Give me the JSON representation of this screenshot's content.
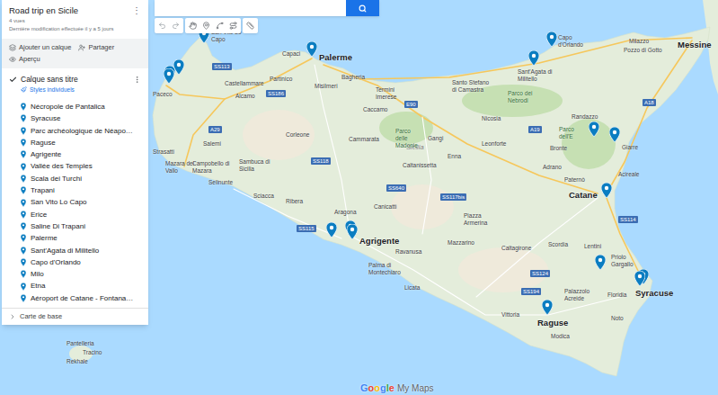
{
  "map": {
    "title": "Road trip en Sicile",
    "views": "4 vues",
    "modified": "Dernière modification effectuée il y a 5 jours",
    "menu": "⋮"
  },
  "actions": [
    {
      "label": "Ajouter un calque"
    },
    {
      "label": "Partager"
    },
    {
      "label": "Aperçu"
    }
  ],
  "layer": {
    "title": "Calque sans titre",
    "checked": true,
    "style": "Styles individuels",
    "items": [
      "Nécropole de Pantalica",
      "Syracuse",
      "Parc archéologique de Néapo…",
      "Raguse",
      "Agrigente",
      "Vallée des Temples",
      "Scala dei Turchi",
      "Trapani",
      "San Vito Lo Capo",
      "Erice",
      "Saline Di Trapani",
      "Palerme",
      "Sant'Agata di Militello",
      "Capo d'Orlando",
      "Milo",
      "Etna",
      "Aéroport de Catane - Fontana…"
    ]
  },
  "base_map": {
    "label": "Carte de base",
    "expanded": false
  },
  "map_labels": [
    {
      "text": "Palerme",
      "kind": "major"
    },
    {
      "text": "Paceco",
      "kind": "city"
    },
    {
      "text": "San Vito Lo Capo",
      "kind": "city"
    },
    {
      "text": "Capaci",
      "kind": "city"
    },
    {
      "text": "Partinico",
      "kind": "city"
    },
    {
      "text": "Castellammare",
      "kind": "city"
    },
    {
      "text": "Alcamo",
      "kind": "city"
    },
    {
      "text": "Misilmeri",
      "kind": "city"
    },
    {
      "text": "Bagheria",
      "kind": "city"
    },
    {
      "text": "Termini Imerese",
      "kind": "city"
    },
    {
      "text": "Caccamo",
      "kind": "city"
    },
    {
      "text": "Corleone",
      "kind": "city"
    },
    {
      "text": "Strasatti",
      "kind": "city"
    },
    {
      "text": "Mazara del Vallo",
      "kind": "city"
    },
    {
      "text": "Campobello di Mazara",
      "kind": "city"
    },
    {
      "text": "Salemi",
      "kind": "city"
    },
    {
      "text": "Selinunte",
      "kind": "city"
    },
    {
      "text": "Sambuca di Sicilia",
      "kind": "city"
    },
    {
      "text": "Sciacca",
      "kind": "city"
    },
    {
      "text": "Ribera",
      "kind": "city"
    },
    {
      "text": "Cammarata",
      "kind": "city"
    },
    {
      "text": "Aragona",
      "kind": "city"
    },
    {
      "text": "Agrigente",
      "kind": "major"
    },
    {
      "text": "Palma di Montechiaro",
      "kind": "city"
    },
    {
      "text": "Canicattì",
      "kind": "city"
    },
    {
      "text": "Ravanusa",
      "kind": "city"
    },
    {
      "text": "Licata",
      "kind": "city"
    },
    {
      "text": "Caltanissetta",
      "kind": "city"
    },
    {
      "text": "Sicilia",
      "kind": "region"
    },
    {
      "text": "Mazzarino",
      "kind": "city"
    },
    {
      "text": "Piazza Armerina",
      "kind": "city"
    },
    {
      "text": "Enna",
      "kind": "city"
    },
    {
      "text": "Leonforte",
      "kind": "city"
    },
    {
      "text": "Nicosia",
      "kind": "city"
    },
    {
      "text": "Gangi",
      "kind": "city"
    },
    {
      "text": "Parco delle Madonie",
      "kind": "park"
    },
    {
      "text": "Parco dei Nebrodi",
      "kind": "park"
    },
    {
      "text": "Santo Stefano di Camastra",
      "kind": "city"
    },
    {
      "text": "Sant'Agata di Militello",
      "kind": "city"
    },
    {
      "text": "Capo d'Orlando",
      "kind": "city"
    },
    {
      "text": "Milazzo",
      "kind": "city"
    },
    {
      "text": "Pozzo di Gotto",
      "kind": "city"
    },
    {
      "text": "Messine",
      "kind": "major"
    },
    {
      "text": "Randazzo",
      "kind": "city"
    },
    {
      "text": "Bronte",
      "kind": "city"
    },
    {
      "text": "Parco dell'E",
      "kind": "park"
    },
    {
      "text": "Adrano",
      "kind": "city"
    },
    {
      "text": "Paternò",
      "kind": "city"
    },
    {
      "text": "Giarre",
      "kind": "city"
    },
    {
      "text": "Acireale",
      "kind": "city"
    },
    {
      "text": "Catane",
      "kind": "major"
    },
    {
      "text": "Caltagirone",
      "kind": "city"
    },
    {
      "text": "Scordia",
      "kind": "city"
    },
    {
      "text": "Lentini",
      "kind": "city"
    },
    {
      "text": "Palazzolo Acreide",
      "kind": "city"
    },
    {
      "text": "Floridia",
      "kind": "city"
    },
    {
      "text": "Priolo Gargallo",
      "kind": "city"
    },
    {
      "text": "Syracuse",
      "kind": "major"
    },
    {
      "text": "Noto",
      "kind": "city"
    },
    {
      "text": "Vittoria",
      "kind": "city"
    },
    {
      "text": "Raguse",
      "kind": "major"
    },
    {
      "text": "Modica",
      "kind": "city"
    },
    {
      "text": "Pantelleria",
      "kind": "city"
    },
    {
      "text": "Tracino",
      "kind": "city"
    },
    {
      "text": "Rekhale",
      "kind": "city"
    }
  ],
  "road_shields": [
    "SS113",
    "A29",
    "SS186",
    "SS118",
    "E90",
    "A19",
    "SS640",
    "SS117bis",
    "SS124",
    "SS114",
    "A18",
    "SS115",
    "SS194"
  ],
  "footer": {
    "brand": "Google",
    "product": "My Maps"
  }
}
